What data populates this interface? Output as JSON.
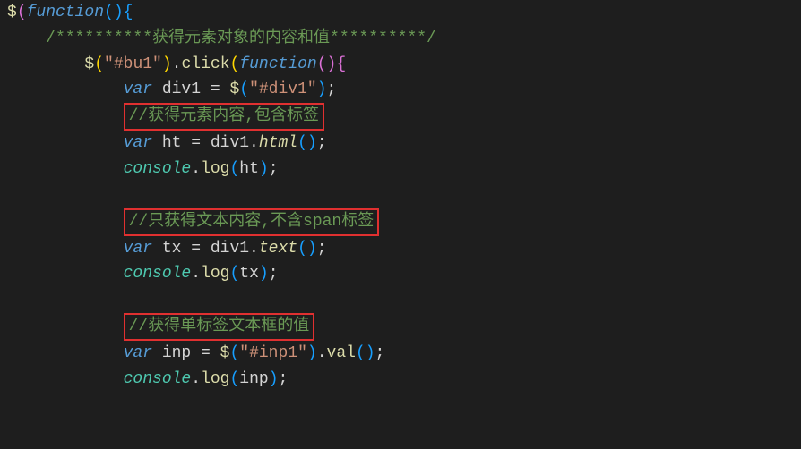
{
  "code": {
    "line1_a": "$",
    "line1_b": "(",
    "line1_c": "function",
    "line1_d": "()",
    "line1_e": "{",
    "line2": "/**********获得元素对象的内容和值**********/",
    "line3_a": "$",
    "line3_b": "(",
    "line3_c": "\"#bu1\"",
    "line3_d": ")",
    "line3_e": ".",
    "line3_f": "click",
    "line3_g": "(",
    "line3_h": "function",
    "line3_i": "()",
    "line3_j": "{",
    "line4_a": "var",
    "line4_b": " div1 = ",
    "line4_c": "$",
    "line4_d": "(",
    "line4_e": "\"#div1\"",
    "line4_f": ")",
    "line4_g": ";",
    "line5": "//获得元素内容,包含标签",
    "line6_a": "var",
    "line6_b": " ht = div1.",
    "line6_c": "html",
    "line6_d": "()",
    "line6_e": ";",
    "line7_a": "console",
    "line7_b": ".",
    "line7_c": "log",
    "line7_d": "(",
    "line7_e": "ht",
    "line7_f": ")",
    "line7_g": ";",
    "line9": "//只获得文本内容,不含span标签",
    "line10_a": "var",
    "line10_b": " tx = div1.",
    "line10_c": "text",
    "line10_d": "()",
    "line10_e": ";",
    "line11_a": "console",
    "line11_b": ".",
    "line11_c": "log",
    "line11_d": "(",
    "line11_e": "tx",
    "line11_f": ")",
    "line11_g": ";",
    "line13": "//获得单标签文本框的值",
    "line14_a": "var",
    "line14_b": " inp = ",
    "line14_c": "$",
    "line14_d": "(",
    "line14_e": "\"#inp1\"",
    "line14_f": ")",
    "line14_g": ".",
    "line14_h": "val",
    "line14_i": "()",
    "line14_j": ";",
    "line15_a": "console",
    "line15_b": ".",
    "line15_c": "log",
    "line15_d": "(",
    "line15_e": "inp",
    "line15_f": ")",
    "line15_g": ";"
  }
}
